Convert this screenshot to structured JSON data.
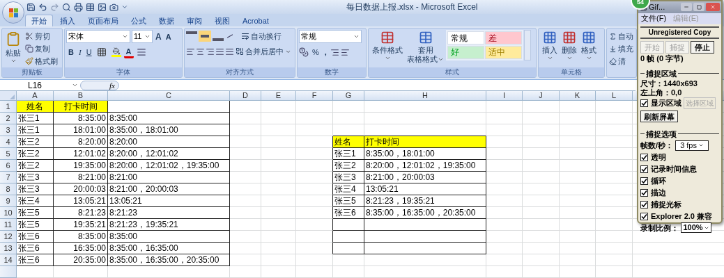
{
  "window": {
    "title": "每日数据上报.xlsx - Microsoft Excel"
  },
  "badge": "54",
  "tabs": [
    {
      "label": "开始",
      "selected": true
    },
    {
      "label": "插入",
      "selected": false
    },
    {
      "label": "页面布局",
      "selected": false
    },
    {
      "label": "公式",
      "selected": false
    },
    {
      "label": "数据",
      "selected": false
    },
    {
      "label": "审阅",
      "selected": false
    },
    {
      "label": "视图",
      "selected": false
    },
    {
      "label": "Acrobat",
      "selected": false
    }
  ],
  "ribbon": {
    "groups": [
      {
        "kind": "clipboard",
        "label": "剪贴板",
        "big": "粘贴",
        "items": [
          "剪切",
          "复制",
          "格式刷"
        ]
      },
      {
        "kind": "font",
        "label": "字体",
        "font": "宋体",
        "size": "11",
        "grow": "A",
        "shrink": "A",
        "bold": "B",
        "italic": "I",
        "underline": "U",
        "font_color": "A"
      },
      {
        "kind": "alignment",
        "label": "对齐方式",
        "wrap": "自动换行",
        "merge": "合并后居中"
      },
      {
        "kind": "number",
        "label": "数字",
        "format": "常规",
        "percent": "%",
        "comma": ","
      },
      {
        "kind": "styles",
        "label": "样式",
        "buttons": [
          {
            "lines": [
              "条件格式"
            ]
          },
          {
            "lines": [
              "套用",
              "表格格式"
            ]
          }
        ],
        "cell_styles": [
          {
            "label": "常规",
            "color": "#ffffff"
          },
          {
            "label": "差",
            "color": "#ffc7ce"
          },
          {
            "label": "好",
            "color": "#c6efce"
          },
          {
            "label": "适中",
            "color": "#ffeb9c"
          }
        ]
      },
      {
        "kind": "cells",
        "label": "单元格",
        "buttons": [
          "插入",
          "删除",
          "格式"
        ]
      },
      {
        "kind": "editing",
        "items": [
          "自动",
          "填充",
          "清"
        ]
      }
    ]
  },
  "formula_bar": {
    "name_box": "L16",
    "function_label": "fx"
  },
  "sheet": {
    "columns": [
      "A",
      "B",
      "C",
      "D",
      "E",
      "F",
      "G",
      "H",
      "I",
      "J",
      "K",
      "L"
    ],
    "rows": [
      "1",
      "2",
      "3",
      "4",
      "5",
      "6",
      "7",
      "8",
      "9",
      "10",
      "11",
      "12",
      "13",
      "14"
    ],
    "tables": [
      {
        "kind": "centered",
        "header": [
          "姓名",
          "打卡时间"
        ],
        "columns": [
          {
            "kind": "text"
          },
          {
            "kind": "time"
          },
          {
            "kind": "text"
          }
        ],
        "rows": [
          [
            "张三1",
            "8:35:00",
            "8:35:00"
          ],
          [
            "张三1",
            "18:01:00",
            "8:35:00，18:01:00"
          ],
          [
            "张三2",
            "8:20:00",
            "8:20:00"
          ],
          [
            "张三2",
            "12:01:02",
            "8:20:00，12:01:02"
          ],
          [
            "张三2",
            "19:35:00",
            "8:20:00，12:01:02，19:35:00"
          ],
          [
            "张三3",
            "8:21:00",
            "8:21:00"
          ],
          [
            "张三3",
            "20:00:03",
            "8:21:00，20:00:03"
          ],
          [
            "张三4",
            "13:05:21",
            "13:05:21"
          ],
          [
            "张三5",
            "8:21:23",
            "8:21:23"
          ],
          [
            "张三5",
            "19:35:21",
            "8:21:23，19:35:21"
          ],
          [
            "张三6",
            "8:35:00",
            "8:35:00"
          ],
          [
            "张三6",
            "16:35:00",
            "8:35:00，16:35:00"
          ],
          [
            "张三6",
            "20:35:00",
            "8:35:00，16:35:00，20:35:00"
          ]
        ]
      },
      {
        "kind": "plain",
        "header": [
          "姓名",
          "打卡时间"
        ],
        "columns": [
          {
            "kind": "text"
          },
          {
            "kind": "text"
          }
        ],
        "rows": [
          [
            "张三1",
            "8:35:00，18:01:00"
          ],
          [
            "张三2",
            "8:20:00，12:01:02，19:35:00"
          ],
          [
            "张三3",
            "8:21:00，20:00:03"
          ],
          [
            "张三4",
            "13:05:21"
          ],
          [
            "张三5",
            "8:21:23，19:35:21"
          ],
          [
            "张三6",
            "8:35:00，16:35:00，20:35:00"
          ]
        ]
      }
    ]
  },
  "capture_tool": {
    "title": "Gif...",
    "menu": [
      {
        "label": "文件(F)",
        "disabled": false
      },
      {
        "label": "编辑(E)",
        "disabled": true
      }
    ],
    "notice": "Unregistered Copy",
    "buttons": [
      {
        "label": "开始",
        "disabled": true
      },
      {
        "label": "捕捉",
        "disabled": true
      },
      {
        "label": "停止",
        "disabled": false
      }
    ],
    "status": "0 帧 (0 字节)",
    "area": {
      "title": "捕捉区域",
      "size": "尺寸：1440x693",
      "origin": "左上角：0,0",
      "show": {
        "label": "显示区域",
        "checked": true
      },
      "select_button": {
        "label": "选择区域",
        "disabled": true
      },
      "refresh_button": "刷新屏幕"
    },
    "options": {
      "title": "捕捉选项",
      "fps_label": "帧数/秒：",
      "fps": "3 fps",
      "checks": [
        {
          "label": "透明",
          "checked": true
        },
        {
          "label": "记录时间信息",
          "checked": true
        },
        {
          "label": "循环",
          "checked": true
        },
        {
          "label": "描边",
          "checked": true
        },
        {
          "label": "捕捉光标",
          "checked": true
        },
        {
          "label": "Explorer 2.0 兼容",
          "checked": true
        }
      ],
      "scale_label": "录制比例：",
      "scale": "100%"
    }
  }
}
